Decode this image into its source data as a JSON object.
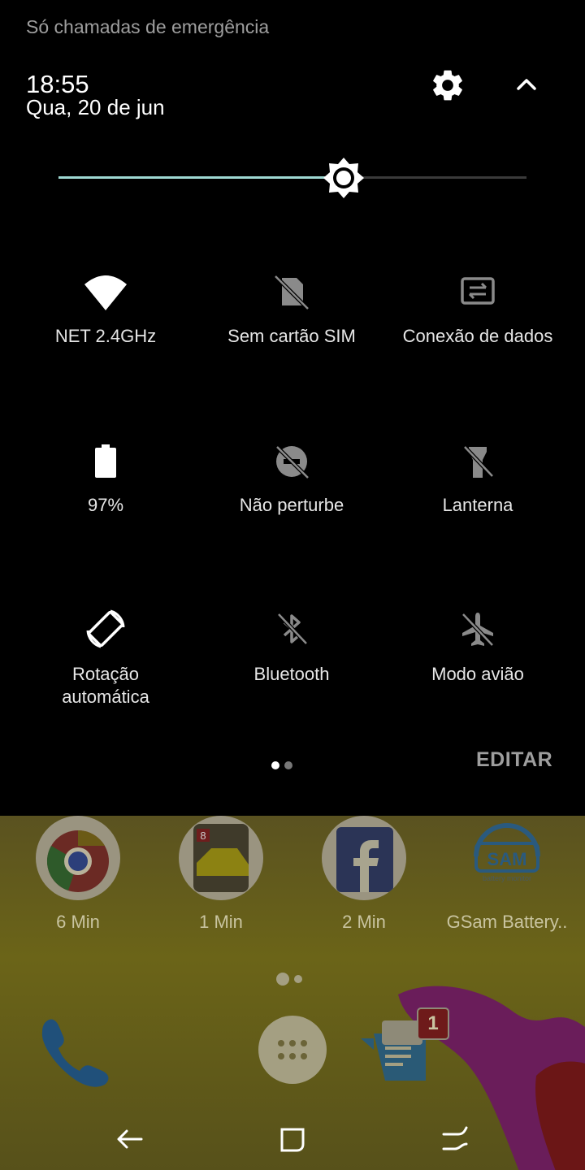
{
  "status": {
    "carrier_text": "Só chamadas de emergência"
  },
  "header": {
    "time": "18:55",
    "date": "Qua, 20 de jun"
  },
  "brightness": {
    "level_percent": 61
  },
  "tiles": [
    {
      "label": "NET 2.4GHz",
      "icon": "wifi-icon",
      "active": true
    },
    {
      "label": "Sem cartão SIM",
      "icon": "no-sim-icon",
      "active": false
    },
    {
      "label": "Conexão de dados",
      "icon": "data-connection-icon",
      "active": false
    },
    {
      "label": "97%",
      "icon": "battery-icon",
      "active": true
    },
    {
      "label": "Não perturbe",
      "icon": "do-not-disturb-icon",
      "active": false
    },
    {
      "label": "Lanterna",
      "icon": "flashlight-icon",
      "active": false
    },
    {
      "label": "Rotação automática",
      "label_line1": "Rotação",
      "label_line2": "automática",
      "icon": "auto-rotate-icon",
      "active": true
    },
    {
      "label": "Bluetooth",
      "icon": "bluetooth-icon",
      "active": false
    },
    {
      "label": "Modo avião",
      "icon": "airplane-icon",
      "active": false
    }
  ],
  "pager": {
    "pages": 2,
    "current": 0
  },
  "edit_label": "EDITAR",
  "home": {
    "apps": [
      {
        "label": "6 Min",
        "icon": "chrome-icon"
      },
      {
        "label": "1 Min",
        "icon": "asphalt-8-icon"
      },
      {
        "label": "2 Min",
        "icon": "facebook-icon"
      },
      {
        "label": "GSam Battery..",
        "icon": "gsam-battery-icon"
      }
    ],
    "gsam_logo_text": "SAM",
    "gsam_logo_subtext": "battery monitor",
    "dock": [
      {
        "icon": "phone-icon"
      },
      {
        "icon": "app-drawer-icon"
      },
      {
        "icon": "messages-icon",
        "badge": "1"
      }
    ]
  },
  "navbar": {
    "icons": [
      "back-icon",
      "recents-icon",
      "home-icon"
    ]
  },
  "colors": {
    "accent": "#9fd9d3",
    "inactive_icon": "#8a8a8a",
    "dimmed_wallpaper": "#6b6418"
  }
}
